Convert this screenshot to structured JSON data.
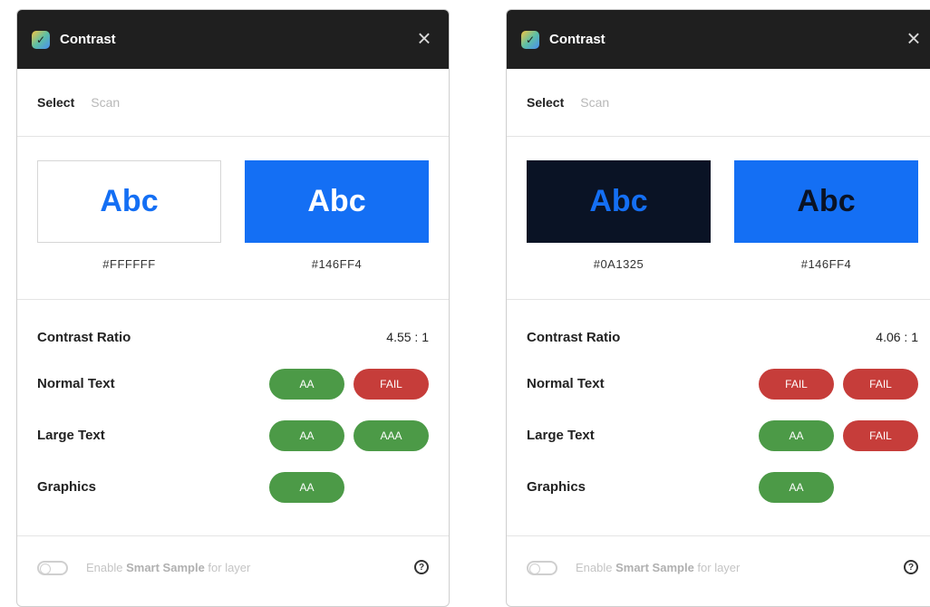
{
  "colors": {
    "titlebar": "#1f1f1f",
    "pass": "#4c9a47",
    "fail": "#c63d3a",
    "accent_blue": "#146FF4"
  },
  "panels": [
    {
      "title": "Contrast",
      "tabs": [
        {
          "label": "Select"
        },
        {
          "label": "Scan"
        }
      ],
      "swatches": [
        {
          "sample": "Abc",
          "hex": "#FFFFFF",
          "bg": "#FFFFFF",
          "fg": "#146FF4"
        },
        {
          "sample": "Abc",
          "hex": "#146FF4",
          "bg": "#146FF4",
          "fg": "#FFFFFF"
        }
      ],
      "contrast_label": "Contrast Ratio",
      "contrast_value": "4.55 : 1",
      "rows": [
        {
          "label": "Normal Text",
          "badges": [
            {
              "text": "AA",
              "status": "pass"
            },
            {
              "text": "FAIL",
              "status": "fail"
            }
          ]
        },
        {
          "label": "Large Text",
          "badges": [
            {
              "text": "AA",
              "status": "pass"
            },
            {
              "text": "AAA",
              "status": "pass"
            }
          ]
        },
        {
          "label": "Graphics",
          "badges": [
            {
              "text": "AA",
              "status": "pass"
            }
          ]
        }
      ],
      "footer": {
        "pre": "Enable ",
        "bold": "Smart Sample",
        "post": " for layer"
      }
    },
    {
      "title": "Contrast",
      "tabs": [
        {
          "label": "Select"
        },
        {
          "label": "Scan"
        }
      ],
      "swatches": [
        {
          "sample": "Abc",
          "hex": "#0A1325",
          "bg": "#0A1325",
          "fg": "#146FF4"
        },
        {
          "sample": "Abc",
          "hex": "#146FF4",
          "bg": "#146FF4",
          "fg": "#0A1325"
        }
      ],
      "contrast_label": "Contrast Ratio",
      "contrast_value": "4.06 : 1",
      "rows": [
        {
          "label": "Normal Text",
          "badges": [
            {
              "text": "FAIL",
              "status": "fail"
            },
            {
              "text": "FAIL",
              "status": "fail"
            }
          ]
        },
        {
          "label": "Large Text",
          "badges": [
            {
              "text": "AA",
              "status": "pass"
            },
            {
              "text": "FAIL",
              "status": "fail"
            }
          ]
        },
        {
          "label": "Graphics",
          "badges": [
            {
              "text": "AA",
              "status": "pass"
            }
          ]
        }
      ],
      "footer": {
        "pre": "Enable ",
        "bold": "Smart Sample",
        "post": " for layer"
      }
    }
  ]
}
